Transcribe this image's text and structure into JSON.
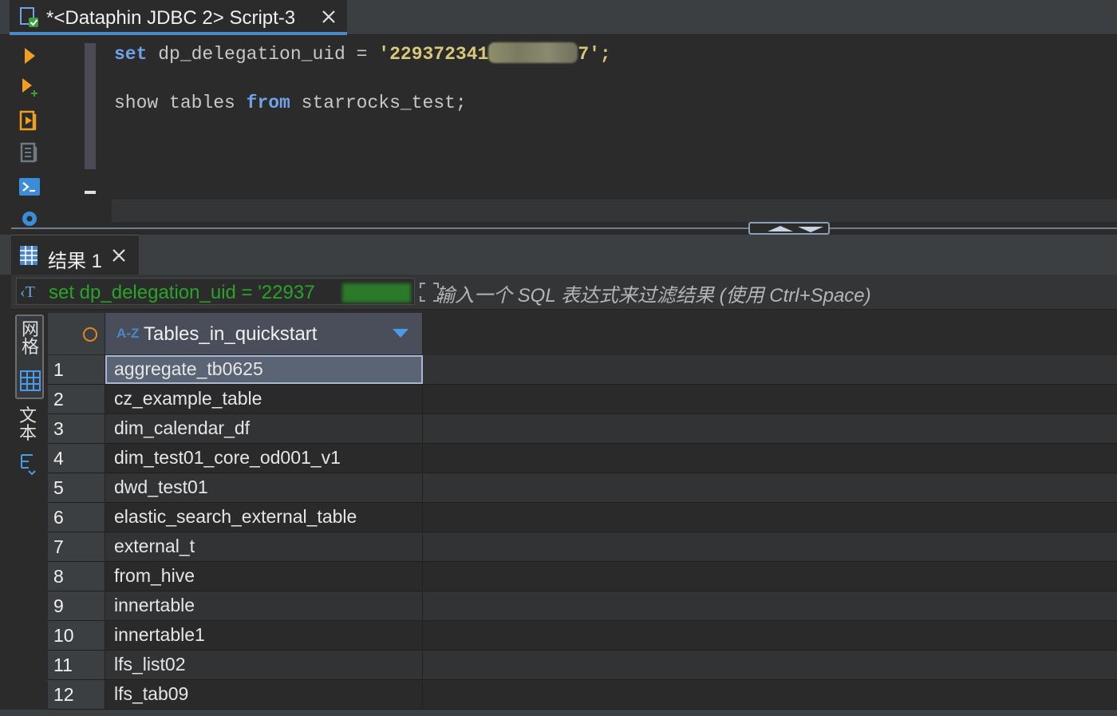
{
  "editor_tab": {
    "title": "*<Dataphin JDBC 2> Script-3"
  },
  "editor": {
    "line1": {
      "keyword": "set",
      "identifier": " dp_delegation_uid = ",
      "string_start": "'229372341",
      "string_end": "7';"
    },
    "line2": {
      "prefix": "show tables ",
      "keyword": "from",
      "suffix": " starrocks_test;"
    }
  },
  "results_tab": {
    "title": "结果 1"
  },
  "filter": {
    "query_text": "set dp_delegation_uid = '22937",
    "placeholder": "输入一个 SQL 表达式来过滤结果 (使用 Ctrl+Space)"
  },
  "mode_bar": {
    "grid_label": "网格",
    "text_label": "文本"
  },
  "grid": {
    "column_header": "Tables_in_quickstart",
    "column_type_icon": "A-Z",
    "rows": [
      {
        "num": "1",
        "value": "aggregate_tb0625"
      },
      {
        "num": "2",
        "value": "cz_example_table"
      },
      {
        "num": "3",
        "value": "dim_calendar_df"
      },
      {
        "num": "4",
        "value": "dim_test01_core_od001_v1"
      },
      {
        "num": "5",
        "value": "dwd_test01"
      },
      {
        "num": "6",
        "value": "elastic_search_external_table"
      },
      {
        "num": "7",
        "value": "external_t"
      },
      {
        "num": "8",
        "value": "from_hive"
      },
      {
        "num": "9",
        "value": "innertable"
      },
      {
        "num": "10",
        "value": "innertable1"
      },
      {
        "num": "11",
        "value": "lfs_list02"
      },
      {
        "num": "12",
        "value": "lfs_tab09"
      }
    ]
  },
  "colors": {
    "accent": "#4a88c7",
    "keyword": "#6fa3e6",
    "string": "#d9c77a",
    "filter_query": "#29a329",
    "run_icon": "#f0a020"
  }
}
